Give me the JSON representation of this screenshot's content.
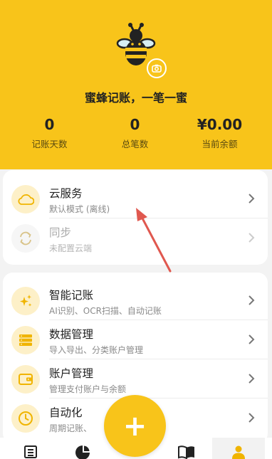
{
  "header": {
    "tagline": "蜜蜂记账，一笔一蜜",
    "background_color": "#f8c41a",
    "logo_icon": "bee-icon",
    "camera_icon": "camera-icon"
  },
  "stats": [
    {
      "value": "0",
      "label": "记账天数"
    },
    {
      "value": "0",
      "label": "总笔数"
    },
    {
      "value": "¥0.00",
      "label": "当前余额"
    }
  ],
  "cloud_card": {
    "items": [
      {
        "title": "云服务",
        "subtitle": "默认模式 (离线)",
        "icon": "cloud-icon",
        "enabled": true
      },
      {
        "title": "同步",
        "subtitle": "未配置云端",
        "icon": "sync-icon",
        "enabled": false
      }
    ]
  },
  "features_card": {
    "items": [
      {
        "title": "智能记账",
        "subtitle": "AI识别、OCR扫描、自动记账",
        "icon": "sparkle-icon"
      },
      {
        "title": "数据管理",
        "subtitle": "导入导出、分类账户管理",
        "icon": "database-icon"
      },
      {
        "title": "账户管理",
        "subtitle": "管理支付账户与余额",
        "icon": "wallet-icon"
      },
      {
        "title": "自动化",
        "subtitle": "周期记账、",
        "icon": "clock-icon"
      }
    ]
  },
  "fab": {
    "icon": "plus-icon"
  },
  "tabbar": {
    "tabs": [
      {
        "icon": "list-icon",
        "active": false
      },
      {
        "icon": "pie-chart-icon",
        "active": false
      },
      {
        "icon": "book-icon",
        "active": false
      },
      {
        "icon": "person-icon",
        "active": true
      }
    ]
  },
  "annotation": {
    "color": "#e0584f"
  }
}
